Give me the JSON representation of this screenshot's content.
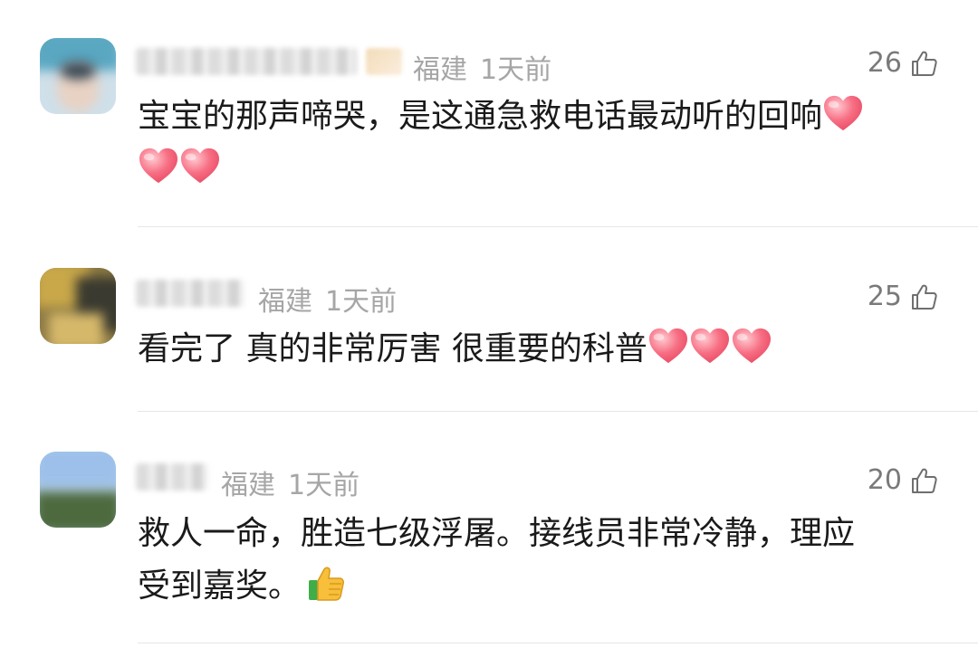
{
  "comments": [
    {
      "location": "福建",
      "time": "1天前",
      "likes": "26",
      "text": "宝宝的那声啼哭，是这通急救电话最动听的回响",
      "hearts_inline": 1,
      "hearts_next_line": 2,
      "avatar_icon": "user-avatar-blurred"
    },
    {
      "location": "福建",
      "time": "1天前",
      "likes": "25",
      "text": "看完了 真的非常厉害 很重要的科普",
      "hearts_inline": 3,
      "avatar_icon": "user-avatar-blurred"
    },
    {
      "location": "福建",
      "time": "1天前",
      "likes": "20",
      "text_line1": "救人一命，胜造七级浮屠。接线员非常冷静，理应",
      "text_line2": "受到嘉奖。",
      "emoji": "thumbs-up-emoji",
      "avatar_icon": "user-avatar-blurred"
    }
  ],
  "icons": {
    "like": "thumb-up-icon",
    "heart": "heart-emoji"
  },
  "colors": {
    "meta": "#a6a6a6",
    "likes": "#7a7a7a",
    "heart": "#f0576e"
  }
}
